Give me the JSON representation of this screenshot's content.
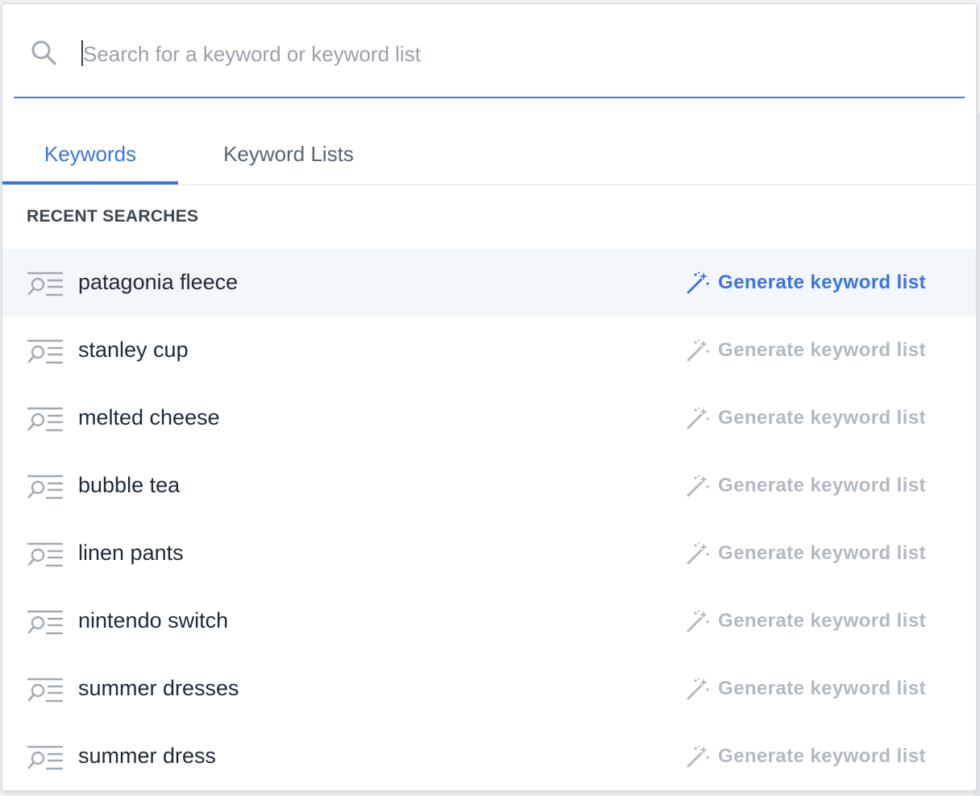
{
  "search": {
    "placeholder": "Search for a keyword or keyword list",
    "value": ""
  },
  "tabs": [
    {
      "label": "Keywords",
      "selected": true
    },
    {
      "label": "Keyword Lists",
      "selected": false
    }
  ],
  "section": {
    "title": "RECENT SEARCHES"
  },
  "recent_searches": [
    {
      "label": "patagonia fleece",
      "action_label": "Generate keyword list",
      "highlighted": true
    },
    {
      "label": "stanley cup",
      "action_label": "Generate keyword list",
      "highlighted": false
    },
    {
      "label": "melted cheese",
      "action_label": "Generate keyword list",
      "highlighted": false
    },
    {
      "label": "bubble tea",
      "action_label": "Generate keyword list",
      "highlighted": false
    },
    {
      "label": "linen pants",
      "action_label": "Generate keyword list",
      "highlighted": false
    },
    {
      "label": "nintendo switch",
      "action_label": "Generate keyword list",
      "highlighted": false
    },
    {
      "label": "summer dresses",
      "action_label": "Generate keyword list",
      "highlighted": false
    },
    {
      "label": "summer dress",
      "action_label": "Generate keyword list",
      "highlighted": false
    }
  ],
  "icons": {
    "search": "search-icon",
    "row": "search-list-icon",
    "action": "magic-wand-icon"
  },
  "colors": {
    "accent": "#3d74e0",
    "muted_action": "#b4b9c1",
    "highlight_row": "#f3f6fa",
    "text_primary": "#1f2937"
  }
}
